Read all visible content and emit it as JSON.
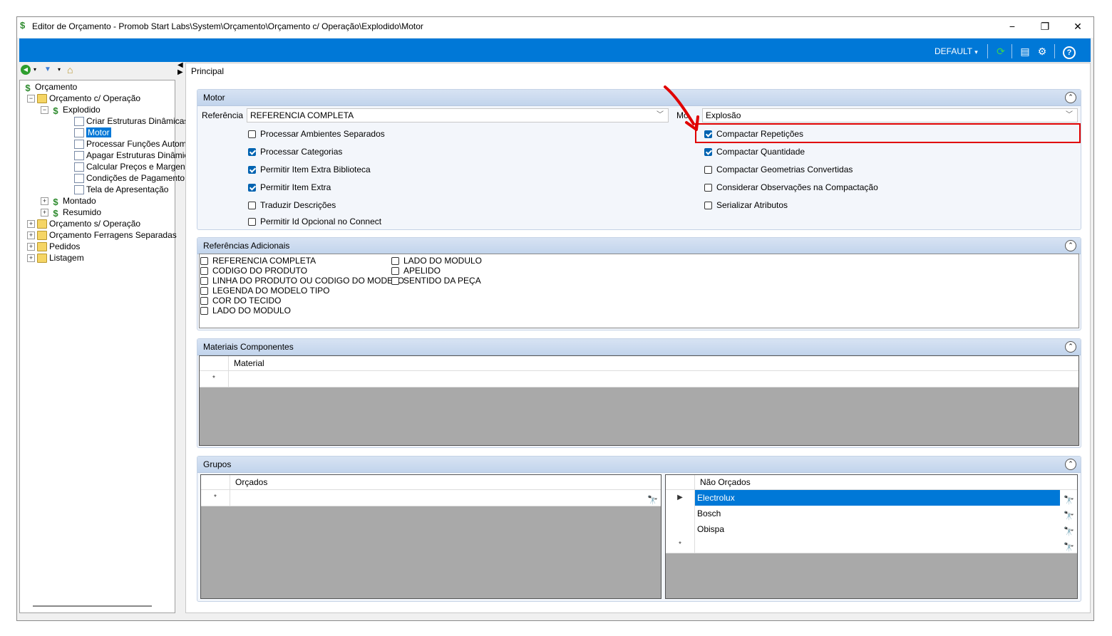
{
  "window": {
    "title": "Editor de Orçamento - Promob Start Labs\\System\\Orçamento\\Orçamento c/ Operação\\Explodido\\Motor",
    "minimize": "−",
    "maximize": "❐",
    "close": "✕"
  },
  "toolbar": {
    "profile_label": "DEFAULT",
    "dropdown_caret": "▾",
    "refresh_icon": "⟳",
    "layout_icon": "▤",
    "settings_icon": "⚙",
    "help_icon": "?"
  },
  "tree": {
    "nav_icons": {
      "back": "◀",
      "forward": "▼",
      "caret": "▾",
      "home": "⌂"
    },
    "items": [
      {
        "label": "Orçamento",
        "level": 0,
        "icon": "money-icon"
      },
      {
        "label": "Orçamento c/ Operação",
        "level": 1,
        "icon": "folder-icon",
        "expander": "−"
      },
      {
        "label": "Explodido",
        "level": 2,
        "icon": "money-icon",
        "expander": "−"
      },
      {
        "label": "Criar Estruturas Dinâmicas",
        "level": 3,
        "icon": "doc-icon"
      },
      {
        "label": "Motor",
        "level": 3,
        "icon": "doc-icon",
        "selected": true
      },
      {
        "label": "Processar Funções Automá",
        "level": 3,
        "icon": "doc-icon"
      },
      {
        "label": "Apagar Estruturas Dinâmica",
        "level": 3,
        "icon": "doc-icon"
      },
      {
        "label": "Calcular Preços e Margens",
        "level": 3,
        "icon": "doc-icon"
      },
      {
        "label": "Condições de Pagamento",
        "level": 3,
        "icon": "doc-icon"
      },
      {
        "label": "Tela de Apresentação",
        "level": 3,
        "icon": "doc-icon"
      },
      {
        "label": "Montado",
        "level": 2,
        "icon": "money-icon",
        "expander": "+"
      },
      {
        "label": "Resumido",
        "level": 2,
        "icon": "money-icon",
        "expander": "+"
      },
      {
        "label": "Orçamento s/ Operação",
        "level": 1,
        "icon": "folder-icon",
        "expander": "+"
      },
      {
        "label": "Orçamento Ferragens Separadas",
        "level": 1,
        "icon": "folder-icon",
        "expander": "+"
      },
      {
        "label": "Pedidos",
        "level": 1,
        "icon": "folder-icon",
        "expander": "+"
      },
      {
        "label": "Listagem",
        "level": 1,
        "icon": "folder-icon",
        "expander": "+"
      }
    ]
  },
  "main": {
    "tab_label": "Principal",
    "motor": {
      "title": "Motor",
      "referencia_label": "Referência",
      "referencia_value": "REFERENCIA COMPLETA",
      "modo_label": "Mo",
      "modo_value": "Explosão",
      "left_options": [
        {
          "label": "Processar Ambientes Separados",
          "checked": false
        },
        {
          "label": "Processar Categorias",
          "checked": true
        },
        {
          "label": "Permitir Item Extra Biblioteca",
          "checked": true
        },
        {
          "label": "Permitir Item Extra",
          "checked": true
        },
        {
          "label": "Traduzir Descrições",
          "checked": false
        },
        {
          "label": "Permitir Id Opcional no Connect",
          "checked": false
        }
      ],
      "right_options": [
        {
          "label": "Compactar Repetições",
          "checked": true
        },
        {
          "label": "Compactar Quantidade",
          "checked": true
        },
        {
          "label": "Compactar Geometrias Convertidas",
          "checked": false
        },
        {
          "label": "Considerar Observações na Compactação",
          "checked": false
        },
        {
          "label": "Serializar Atributos",
          "checked": false
        }
      ]
    },
    "referencias": {
      "title": "Referências Adicionais",
      "col1": [
        "REFERENCIA COMPLETA",
        "CODIGO DO PRODUTO",
        "LINHA DO PRODUTO OU CODIGO DO MODELO",
        "LEGENDA DO MODELO TIPO",
        "COR DO TECIDO",
        "LADO DO MODULO"
      ],
      "col2": [
        "LADO DO MODULO",
        "APELIDO",
        "SENTIDO DA PEÇA"
      ]
    },
    "materiais": {
      "title": "Materiais Componentes",
      "column": "Material",
      "new_row_marker": "*"
    },
    "grupos": {
      "title": "Grupos",
      "orcados": {
        "column": "Orçados",
        "new_row_marker": "*"
      },
      "nao_orcados": {
        "column": "Não Orçados",
        "rows": [
          "Electrolux",
          "Bosch",
          "Obispa"
        ],
        "current_marker": "▶",
        "new_row_marker": "*"
      }
    },
    "collapse_icon": "⌃",
    "binoculars_icon": "🔭"
  },
  "colors": {
    "accent": "#0078d7",
    "highlight": "#e00000"
  }
}
